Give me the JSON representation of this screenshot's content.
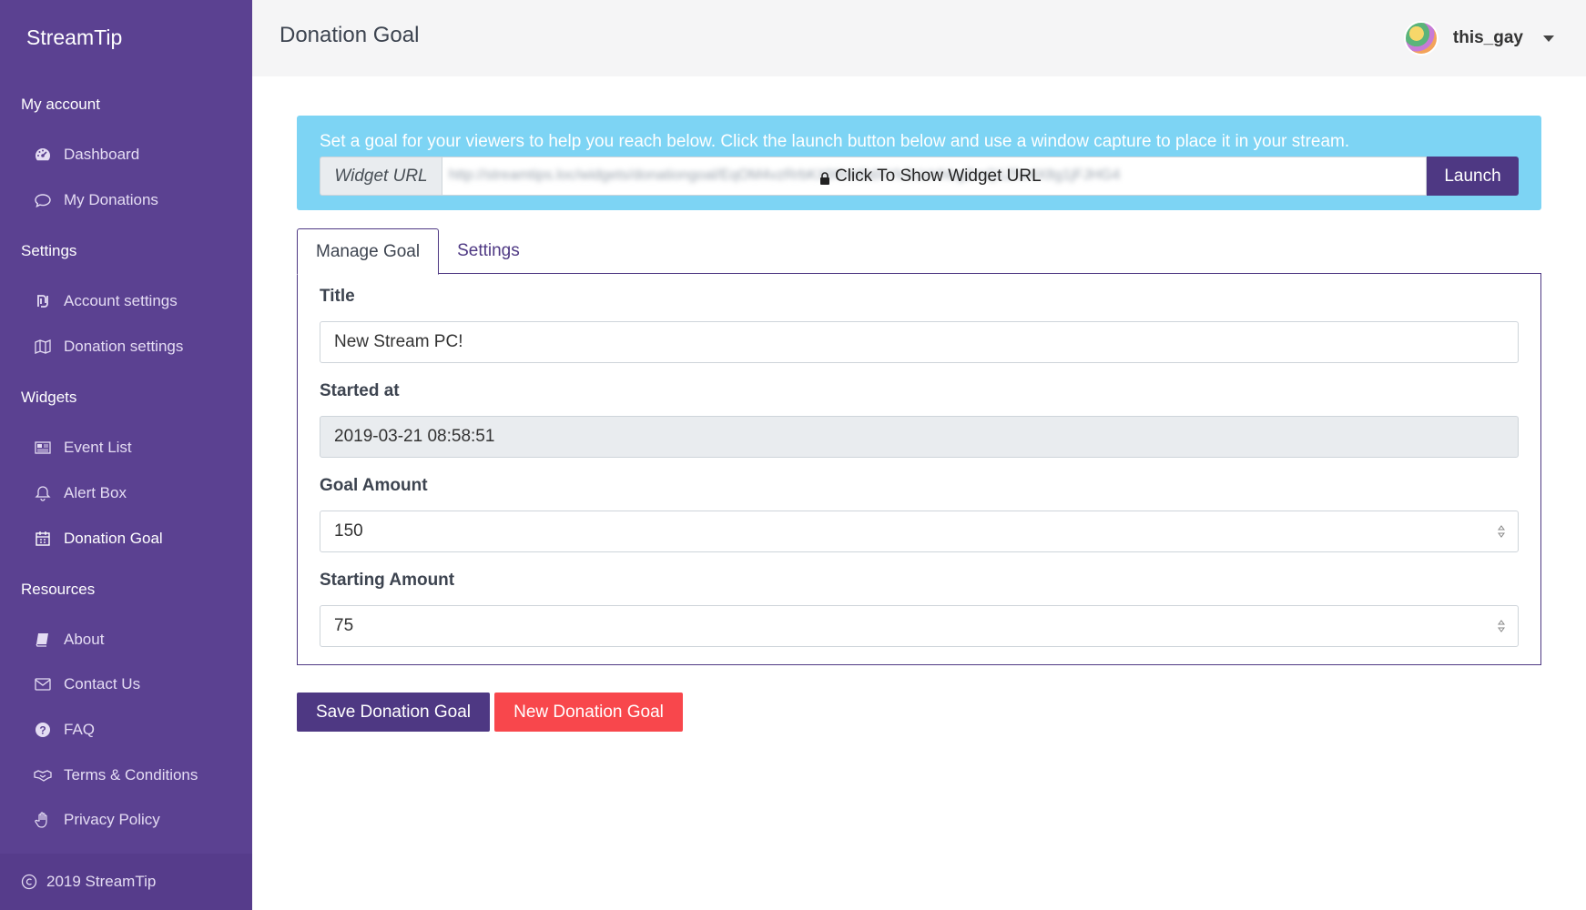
{
  "sidebar": {
    "brand": "StreamTip",
    "sections": [
      {
        "label": "My account"
      },
      {
        "label": "Settings"
      },
      {
        "label": "Widgets"
      },
      {
        "label": "Resources"
      }
    ],
    "items": [
      {
        "label": "Dashboard",
        "icon": "tachometer-icon"
      },
      {
        "label": "My Donations",
        "icon": "comment-icon"
      },
      {
        "label": "Account settings",
        "icon": "shekel-icon"
      },
      {
        "label": "Donation settings",
        "icon": "map-icon"
      },
      {
        "label": "Event List",
        "icon": "newspaper-icon"
      },
      {
        "label": "Alert Box",
        "icon": "bell-icon"
      },
      {
        "label": "Donation Goal",
        "icon": "calendar-icon",
        "active": true
      },
      {
        "label": "About",
        "icon": "book-icon"
      },
      {
        "label": "Contact Us",
        "icon": "envelope-icon"
      },
      {
        "label": "FAQ",
        "icon": "question-circle-icon"
      },
      {
        "label": "Terms & Conditions",
        "icon": "handshake-icon"
      },
      {
        "label": "Privacy Policy",
        "icon": "hand-paper-icon"
      }
    ],
    "footer": "2019 StreamTip"
  },
  "header": {
    "title": "Donation Goal",
    "username": "this_gay"
  },
  "alert": {
    "text": "Set a goal for your viewers to help you reach below. Click the launch button below and use a window capture to place it in your stream.",
    "url_label": "Widget URL",
    "url_blurred": "http://streamtips.loc/widgets/donationgoal/EqOM4vzRrbKXfAhM8dXYk3UzHhbgZmQ1Zfw4X8g1jFJHG4",
    "url_reveal": "Click To Show Widget URL",
    "launch_label": "Launch"
  },
  "tabs": [
    {
      "label": "Manage Goal",
      "active": true
    },
    {
      "label": "Settings",
      "active": false
    }
  ],
  "form": {
    "title_label": "Title",
    "title_value": "New Stream PC!",
    "started_label": "Started at",
    "started_value": "2019-03-21 08:58:51",
    "goal_label": "Goal Amount",
    "goal_value": "150",
    "starting_label": "Starting Amount",
    "starting_value": "75"
  },
  "buttons": {
    "save_label": "Save Donation Goal",
    "new_label": "New Donation Goal"
  },
  "colors": {
    "sidebar": "#5b4191",
    "primary": "#4e3883",
    "alert": "#7dd4f4",
    "danger": "#f8474c"
  }
}
